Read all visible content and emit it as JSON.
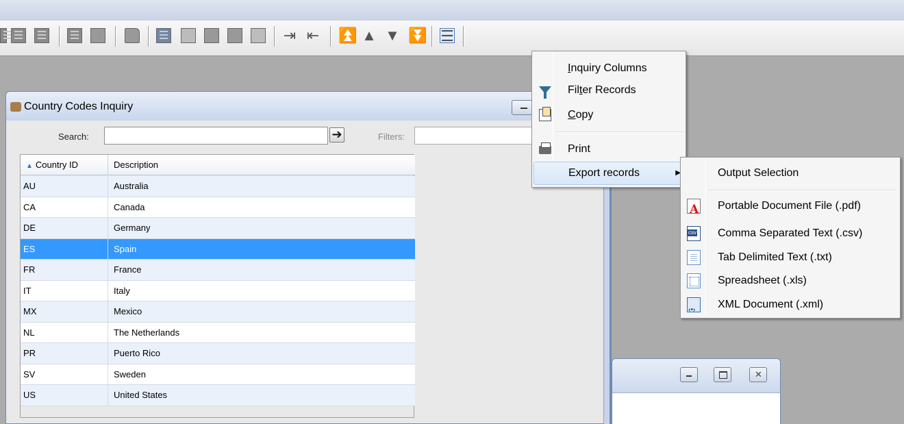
{
  "window": {
    "title": "Country Codes Inquiry",
    "search_label": "Search:",
    "search_value": "",
    "go_glyph": "➔",
    "filters_label": "Filters:",
    "filters_value": ""
  },
  "grid": {
    "sort_glyph": "▲",
    "columns": [
      "Country ID",
      "Description"
    ],
    "selected_row": "ES",
    "rows": [
      {
        "id": "AU",
        "description": "Australia"
      },
      {
        "id": "CA",
        "description": "Canada"
      },
      {
        "id": "DE",
        "description": "Germany"
      },
      {
        "id": "ES",
        "description": "Spain"
      },
      {
        "id": "FR",
        "description": "France"
      },
      {
        "id": "IT",
        "description": "Italy"
      },
      {
        "id": "MX",
        "description": "Mexico"
      },
      {
        "id": "NL",
        "description": "The Netherlands"
      },
      {
        "id": "PR",
        "description": "Puerto Rico"
      },
      {
        "id": "SV",
        "description": "Sweden"
      },
      {
        "id": "US",
        "description": "United States"
      }
    ]
  },
  "context_menu": {
    "items": [
      {
        "label_pre": "",
        "label_u": "I",
        "label_post": "nquiry Columns",
        "icon": "none"
      },
      {
        "label_pre": "Fil",
        "label_u": "t",
        "label_post": "er Records",
        "icon": "filter-icon"
      },
      {
        "label_pre": "",
        "label_u": "C",
        "label_post": "opy",
        "icon": "copy-icon"
      },
      {
        "label_pre": "Print",
        "label_u": "",
        "label_post": "",
        "icon": "print-icon"
      },
      {
        "label_pre": "Export records",
        "label_u": "",
        "label_post": "",
        "icon": "none"
      }
    ],
    "submenu_glyph": "▶"
  },
  "export_submenu": {
    "header": "Output Selection",
    "items": [
      {
        "label": "Portable Document File (.pdf)",
        "icon": "pdf-icon"
      },
      {
        "label": "Comma Separated Text (.csv)",
        "icon": "csv-icon"
      },
      {
        "label": "Tab Delimited Text (.txt)",
        "icon": "txt-icon"
      },
      {
        "label": "Spreadsheet (.xls)",
        "icon": "xls-icon"
      },
      {
        "label": "XML Document (.xml)",
        "icon": "xml-icon"
      }
    ]
  },
  "toolbar_icons": [
    "first-record-icon",
    "first-page-icon",
    "grid-icon",
    "grid-dark-icon",
    "form-icon",
    "book-icon",
    "calculator-icon",
    "chart-icon",
    "copy-records-icon",
    "paste-icon",
    "edit-icon",
    "import-icon",
    "export-icon",
    "move-top-icon",
    "move-up-icon",
    "move-down-icon",
    "move-bottom-icon",
    "report-menu-icon"
  ]
}
